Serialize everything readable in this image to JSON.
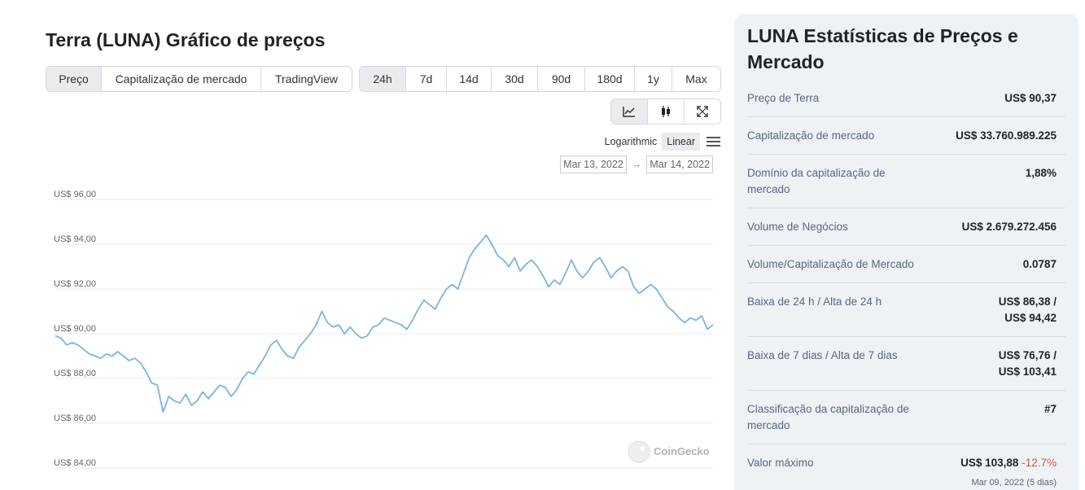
{
  "header": {
    "title": "Terra (LUNA) Gráfico de preços"
  },
  "view_tabs": [
    "Preço",
    "Capitalização de mercado",
    "TradingView"
  ],
  "range_tabs": [
    "24h",
    "7d",
    "14d",
    "30d",
    "90d",
    "180d",
    "1y",
    "Max"
  ],
  "icon_tabs": [
    "line-chart-icon",
    "candlestick-icon",
    "fullscreen-icon"
  ],
  "scale": {
    "log_label": "Logarithmic",
    "linear_label": "Linear"
  },
  "date_range": {
    "from": "Mar 13, 2022",
    "arrow": "→",
    "to": "Mar 14, 2022"
  },
  "watermark": {
    "text": "CoinGecko"
  },
  "colors": {
    "line": "#7fb3e0",
    "grid": "#ebebeb",
    "negative": "#e15241",
    "panel": "#eff2f5"
  },
  "chart_data": {
    "type": "line",
    "ylim": [
      84,
      96
    ],
    "yticks": [
      96,
      94,
      92,
      90,
      88,
      86,
      84
    ],
    "ytick_labels": [
      "US$ 96,00",
      "US$ 94,00",
      "US$ 92,00",
      "US$ 90,00",
      "US$ 88,00",
      "US$ 86,00",
      "US$ 84,00"
    ],
    "grid": true,
    "x_range": [
      "Mar 13, 2022",
      "Mar 14, 2022"
    ],
    "series": [
      {
        "values": [
          89.9,
          89.8,
          89.5,
          89.6,
          89.5,
          89.3,
          89.1,
          89.0,
          88.9,
          89.1,
          89.0,
          89.2,
          89.0,
          88.8,
          88.9,
          88.7,
          88.3,
          87.8,
          87.7,
          86.5,
          87.2,
          87.0,
          86.9,
          87.3,
          86.8,
          87.0,
          87.4,
          87.1,
          87.4,
          87.7,
          87.6,
          87.2,
          87.5,
          88.0,
          88.3,
          88.2,
          88.6,
          89.0,
          89.5,
          89.7,
          89.3,
          89.0,
          88.9,
          89.4,
          89.7,
          90.0,
          90.4,
          91.0,
          90.5,
          90.3,
          90.4,
          90.0,
          90.3,
          90.0,
          89.8,
          89.9,
          90.3,
          90.4,
          90.7,
          90.6,
          90.5,
          90.4,
          90.2,
          90.6,
          91.1,
          91.5,
          91.3,
          91.1,
          91.6,
          92.0,
          92.2,
          92.0,
          92.7,
          93.4,
          93.8,
          94.1,
          94.4,
          94.0,
          93.5,
          93.3,
          93.0,
          93.4,
          92.8,
          93.1,
          93.3,
          93.0,
          92.6,
          92.1,
          92.4,
          92.2,
          92.7,
          93.3,
          92.8,
          92.5,
          92.8,
          93.2,
          93.4,
          93.0,
          92.5,
          92.8,
          93.0,
          92.8,
          92.1,
          91.8,
          92.0,
          92.2,
          92.0,
          91.6,
          91.2,
          91.0,
          90.7,
          90.5,
          90.7,
          90.6,
          90.8,
          90.2,
          90.4
        ]
      }
    ]
  },
  "stats": {
    "title": "LUNA Estatísticas de Preços e Mercado",
    "rows": [
      {
        "label": "Preço de Terra",
        "value": "US$ 90,37"
      },
      {
        "label": "Capitalização de mercado",
        "value": "US$ 33.760.989.225"
      },
      {
        "label": "Domínio da capitalização de mercado",
        "value": "1,88%"
      },
      {
        "label": "Volume de Negócios",
        "value": "US$ 2.679.272.456"
      },
      {
        "label": "Volume/Capitalização de Mercado",
        "value": "0.0787"
      },
      {
        "label": "Baixa de 24 h / Alta de 24 h",
        "value": "US$ 86,38 /",
        "value2": "US$ 94,42"
      },
      {
        "label": "Baixa de 7 dias / Alta de 7 dias",
        "value": "US$ 76,76 /",
        "value2": "US$ 103,41"
      },
      {
        "label": "Classificação da capitalização de mercado",
        "value": "#7"
      },
      {
        "label": "Valor máximo",
        "value": "US$ 103,88",
        "change": "-12.7%",
        "sub": "Mar 09, 2022 (5 dias)"
      }
    ]
  }
}
